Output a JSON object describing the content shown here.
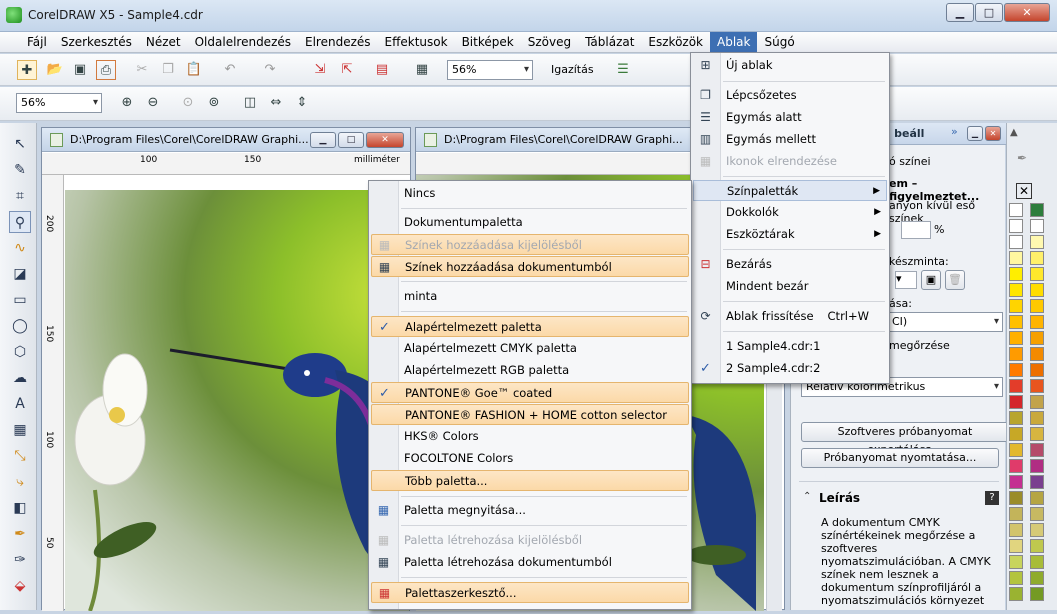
{
  "window": {
    "title": "CorelDRAW X5 - Sample4.cdr",
    "buttons": [
      "▁",
      "□",
      "✕"
    ]
  },
  "menubar": [
    "Fájl",
    "Szerkesztés",
    "Nézet",
    "Oldalelrendezés",
    "Elrendezés",
    "Effektusok",
    "Bitképek",
    "Szöveg",
    "Táblázat",
    "Eszközök",
    "Ablak",
    "Súgó"
  ],
  "toolbar": {
    "zoom": "56%",
    "align_label": "Igazítás"
  },
  "propbar": {
    "zoom": "56%"
  },
  "docs": [
    {
      "title": "D:\\Program Files\\Corel\\CorelDRAW Graphi...",
      "unit": "milliméter",
      "ruler_top": [
        "100",
        "150"
      ],
      "ruler_left": [
        "200",
        "150",
        "100",
        "50"
      ]
    },
    {
      "title": "D:\\Program Files\\Corel\\CorelDRAW Graphi...",
      "ruler_top": [
        "100",
        "150"
      ]
    }
  ],
  "ablak_menu": [
    {
      "label": "Új ablak",
      "icon": "new-window-icon"
    },
    {
      "label": "Lépcsőzetes",
      "icon": "cascade-icon"
    },
    {
      "label": "Egymás alatt",
      "icon": "tile-horizontal-icon"
    },
    {
      "label": "Egymás mellett",
      "icon": "tile-vertical-icon"
    },
    {
      "label": "Ikonok elrendezése",
      "icon": "arrange-icons-icon",
      "disabled": true
    },
    {
      "label": "Színpaletták",
      "submenu": true,
      "highlighted": true
    },
    {
      "label": "Dokkolók",
      "submenu": true
    },
    {
      "label": "Eszköztárak",
      "submenu": true
    },
    {
      "label": "Bezárás",
      "icon": "close-window-icon"
    },
    {
      "label": "Mindent bezár",
      "icon": "close-all-icon"
    },
    {
      "label": "Ablak frissítése",
      "icon": "refresh-window-icon",
      "shortcut": "Ctrl+W"
    },
    {
      "label": "1 Sample4.cdr:1"
    },
    {
      "label": "2 Sample4.cdr:2",
      "checked": true
    }
  ],
  "palette_menu": [
    {
      "label": "Nincs"
    },
    {
      "label": "Dokumentumpaletta"
    },
    {
      "label": "Színek hozzáadása kijelölésből",
      "disabled": true,
      "highlighted": true
    },
    {
      "label": "Színek hozzáadása dokumentumból",
      "highlighted": true
    },
    {
      "label": "minta"
    },
    {
      "label": "Alapértelmezett paletta",
      "checked": true,
      "highlighted": true
    },
    {
      "label": "Alapértelmezett CMYK paletta"
    },
    {
      "label": "Alapértelmezett RGB paletta"
    },
    {
      "label": "PANTONE® Goe™ coated",
      "checked": true,
      "highlighted": true
    },
    {
      "label": "PANTONE® FASHION + HOME cotton selector",
      "highlighted": true
    },
    {
      "label": "HKS® Colors"
    },
    {
      "label": "FOCOLTONE Colors"
    },
    {
      "label": "Több paletta...",
      "highlighted": true
    },
    {
      "label": "Paletta megnyitása..."
    },
    {
      "label": "Paletta létrehozása kijelölésből",
      "disabled": true
    },
    {
      "label": "Paletta létrehozása dokumentumból"
    },
    {
      "label": "Palettaszerkesztő...",
      "highlighted": true
    }
  ],
  "dock": {
    "title_partial": "ió beáll",
    "lines": [
      "ó színei",
      "em – figyelmeztet...",
      "anyon kívül eső színek",
      "%",
      "készminta:",
      "ása:",
      "CI)",
      "megőrzése"
    ],
    "intent": "Relatív kolorimetrikus",
    "export_btn": "Szoftveres próbanyomat exportálása...",
    "print_btn": "Próbanyomat nyomtatása...",
    "desc_title": "Leírás",
    "desc_text": "A dokumentum CMYK színértékeinek megőrzése a szoftveres nyomatszimulációban. A CMYK színek nem lesznek a dokumentum színprofiljáról a nyomatszimulációs környezet"
  },
  "colors": {
    "accent": "#3d6fb3",
    "highlight": "#fbd9a8",
    "canvas": "#8cbf2a"
  }
}
